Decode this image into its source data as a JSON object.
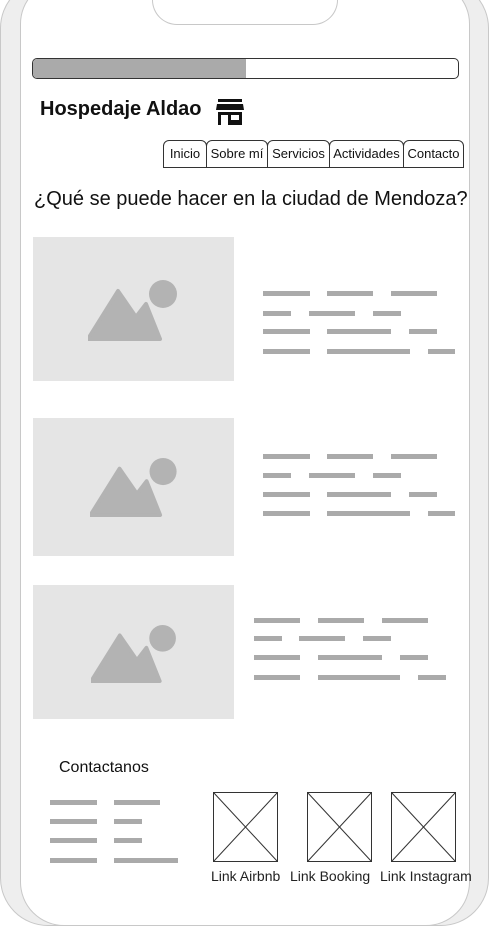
{
  "progress": 0.5,
  "brand": {
    "name": "Hospedaje Aldao",
    "icon": "store-icon"
  },
  "nav": {
    "tabs": [
      "Inicio",
      "Sobre mí",
      "Servicios",
      "Actividades",
      "Contacto"
    ]
  },
  "main": {
    "heading": "¿Qué se puede hacer en la ciudad de Mendoza?"
  },
  "cards": [
    {
      "image": "image-placeholder-icon"
    },
    {
      "image": "image-placeholder-icon"
    },
    {
      "image": "image-placeholder-icon"
    }
  ],
  "contact": {
    "title": "Contactanos",
    "links": [
      "Link Airbnb",
      "Link Booking",
      "Link Instagram"
    ]
  },
  "colors": {
    "placeholder_bg": "#e5e5e5",
    "placeholder_shape": "#b3b3b3",
    "progress_fill": "#aaaaaa"
  }
}
